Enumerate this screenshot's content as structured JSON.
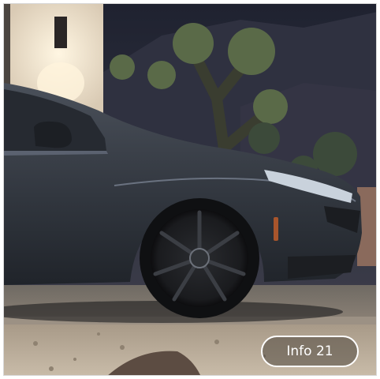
{
  "image": {
    "subject-icon": "car-photo",
    "colors": {
      "sky": "#2b2e3c",
      "wall": "#e8dccb",
      "car_body": "#3a3f47",
      "gravel": "#b9ab99"
    }
  },
  "info_button": {
    "label": "Info 21"
  }
}
